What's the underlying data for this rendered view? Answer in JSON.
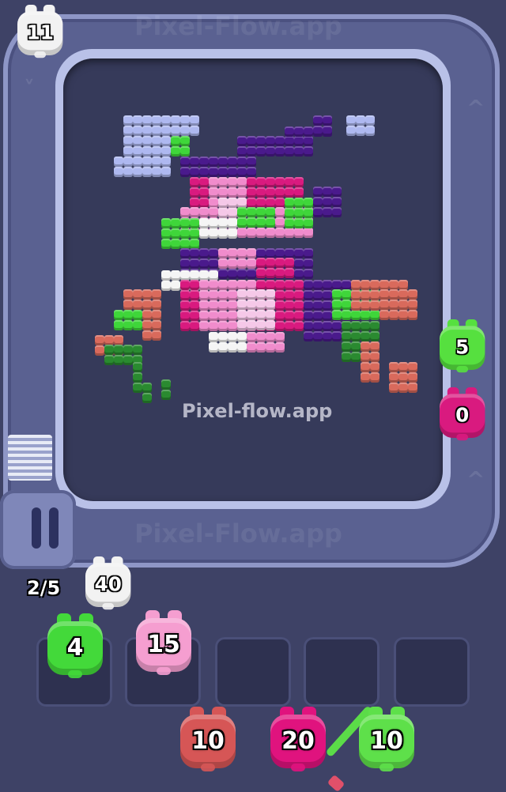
{
  "watermark": {
    "top": "Pixel-Flow.app",
    "bottom": "Pixel-Flow.app",
    "center": "Pixel-flow.app"
  },
  "queue_progress": "2/5",
  "track_pigs": [
    {
      "count": "11",
      "color": "#f2f2f2"
    },
    {
      "count": "5",
      "color": "#56e03f"
    },
    {
      "count": "0",
      "color": "#d91a7f"
    }
  ],
  "launch_pig": {
    "count": "40",
    "color": "#f2f2f2"
  },
  "slot_pigs": [
    {
      "count": "4",
      "color": "#43d93a"
    },
    {
      "count": "15",
      "color": "#f59ed0"
    }
  ],
  "queue_pigs": [
    {
      "count": "10",
      "color": "#d65656"
    },
    {
      "count": "20",
      "color": "#e0137e"
    },
    {
      "count": "10",
      "color": "#5ee04a"
    }
  ],
  "palette": {
    "purple": "#4a1a8c",
    "magenta": "#d91a7f",
    "pink": "#f08ccc",
    "lightpink": "#f5c8e8",
    "white": "#f5f5f5",
    "green": "#3fd63a",
    "darkgreen": "#2a8a30",
    "lavender": "#aeb8f0",
    "salmon": "#d96a5c"
  }
}
